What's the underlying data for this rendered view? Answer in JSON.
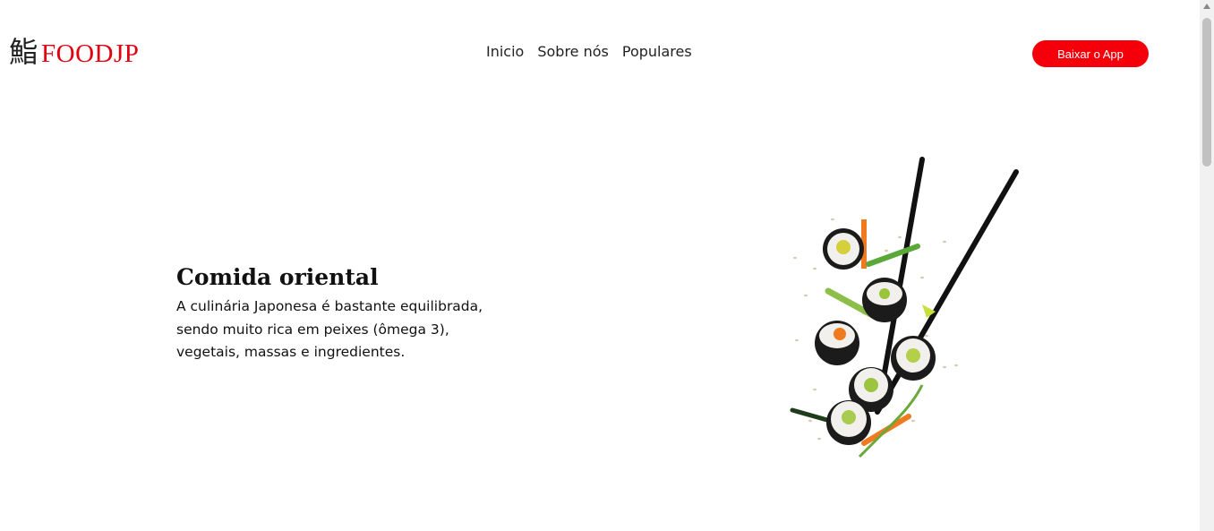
{
  "logo": {
    "kanji": "鮨",
    "text": "FOODJP"
  },
  "nav": {
    "items": [
      {
        "label": "Inicio"
      },
      {
        "label": "Sobre nós"
      },
      {
        "label": "Populares"
      }
    ]
  },
  "cta": {
    "label": "Baixar o App"
  },
  "hero": {
    "title": "Comida oriental",
    "description": "A culinária Japonesa é bastante equilibrada, sendo muito rica em peixes (ômega 3), vegetais, massas e ingredientes."
  },
  "colors": {
    "brand_red": "#e3000f",
    "button_red": "#f5000a"
  },
  "icons": {
    "hero_image": "sushi-chopsticks-illustration"
  }
}
